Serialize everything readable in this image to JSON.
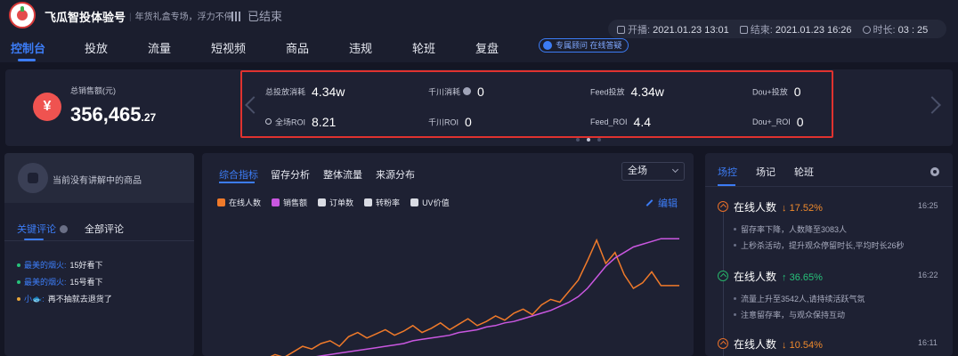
{
  "header": {
    "shop_name": "飞瓜智投体验号",
    "shop_tag": "年货礼盒专场，浮力不停",
    "status": "已结束",
    "start_label": "开播:",
    "start_time": "2021.01.23 13:01",
    "end_label": "结束:",
    "end_time": "2021.01.23 16:26",
    "duration_label": "时长:",
    "duration": "03 : 25"
  },
  "nav": {
    "items": [
      "控制台",
      "投放",
      "流量",
      "短视频",
      "商品",
      "违规",
      "轮班",
      "复盘"
    ],
    "advisor": "专属顾问 在线答疑"
  },
  "sales": {
    "label": "总销售额(元)",
    "value_main": "356,465",
    "value_decimal": ".27",
    "metrics": [
      {
        "label": "总投放消耗",
        "value": "4.34w"
      },
      {
        "label": "千川消耗",
        "value": "0"
      },
      {
        "label": "Feed投放",
        "value": "4.34w"
      },
      {
        "label": "Dou+投放",
        "value": "0"
      },
      {
        "label": "全场ROI",
        "value": "8.21"
      },
      {
        "label": "千川ROI",
        "value": "0"
      },
      {
        "label": "Feed_ROI",
        "value": "4.4"
      },
      {
        "label": "Dou+_ROI",
        "value": "0"
      }
    ]
  },
  "left_panel": {
    "no_product": "当前没有讲解中的商品",
    "tabs": [
      "关键评论",
      "全部评论"
    ],
    "comments": [
      {
        "user": "最美的烟火:",
        "text": "15好看下",
        "color": "#27c27a"
      },
      {
        "user": "最美的烟火:",
        "text": "15号看下",
        "color": "#27c27a"
      },
      {
        "user": "小🐟:",
        "text": "再不抽就去退货了",
        "color": "#e8a53a"
      }
    ]
  },
  "chart_panel": {
    "tabs": [
      "综合指标",
      "留存分析",
      "整体流量",
      "来源分布"
    ],
    "scope": "全场",
    "legend": [
      {
        "name": "在线人数",
        "color": "#f07a2a",
        "on": true
      },
      {
        "name": "销售额",
        "color": "#c957e0",
        "on": true
      },
      {
        "name": "订单数",
        "color": "#d9dbe3",
        "on": false
      },
      {
        "name": "转粉率",
        "color": "#d9dbe3",
        "on": false
      },
      {
        "name": "UV价值",
        "color": "#d9dbe3",
        "on": false
      }
    ],
    "edit": "编辑"
  },
  "chart_data": {
    "type": "line",
    "series": [
      {
        "name": "在线人数",
        "color": "#f07a2a",
        "values": [
          0,
          2,
          4,
          3,
          6,
          9,
          12,
          10,
          14,
          18,
          16,
          20,
          22,
          18,
          25,
          28,
          24,
          27,
          30,
          26,
          29,
          33,
          28,
          31,
          35,
          30,
          34,
          38,
          33,
          36,
          40,
          37,
          42,
          45,
          41,
          48,
          52,
          50,
          58,
          66,
          80,
          95,
          78,
          86,
          70,
          60,
          64,
          72,
          62,
          62,
          62
        ]
      },
      {
        "name": "销售额",
        "color": "#c957e0",
        "values": [
          0,
          1,
          2,
          3,
          4,
          5,
          6,
          7,
          8,
          9,
          10,
          11,
          12,
          13,
          14,
          15,
          16,
          17,
          18,
          19,
          20,
          22,
          23,
          24,
          25,
          26,
          28,
          29,
          30,
          32,
          33,
          35,
          36,
          38,
          40,
          42,
          44,
          47,
          50,
          54,
          60,
          68,
          76,
          82,
          86,
          90,
          92,
          94,
          96,
          96,
          96
        ]
      }
    ],
    "ylim": [
      0,
      100
    ]
  },
  "right_panel": {
    "tabs": [
      "场控",
      "场记",
      "轮班"
    ],
    "events": [
      {
        "title": "在线人数",
        "change": "↓ 17.52%",
        "dir": "down",
        "time": "16:25",
        "desc": [
          "留存率下降，人数降至3083人",
          "上秒杀活动，提升观众停留时长,平均时长26秒"
        ]
      },
      {
        "title": "在线人数",
        "change": "↑ 36.65%",
        "dir": "up",
        "time": "16:22",
        "desc": [
          "流量上升至3542人,请持续活跃气氛",
          "注意留存率，与观众保持互动"
        ]
      },
      {
        "title": "在线人数",
        "change": "↓ 10.54%",
        "dir": "down",
        "time": "16:11",
        "desc": []
      }
    ]
  }
}
